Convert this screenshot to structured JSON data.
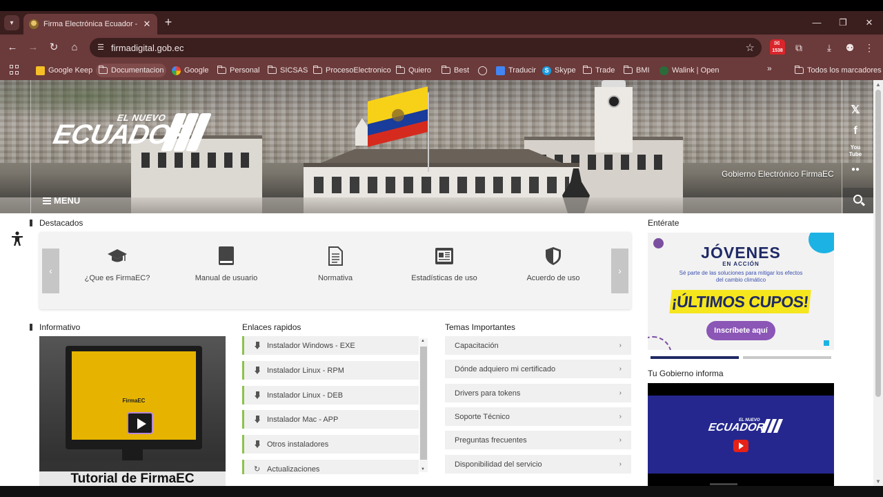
{
  "browser": {
    "tab_title": "Firma Electrónica Ecuador - Firma",
    "url": "firmadigital.gob.ec",
    "ext_badge": "1538",
    "bookmarks": [
      {
        "label": "Google Keep",
        "icon": "keep-icon"
      },
      {
        "label": "Documentacion",
        "icon": "folder-icon"
      },
      {
        "label": "Google",
        "icon": "google-icon"
      },
      {
        "label": "Personal",
        "icon": "folder-icon"
      },
      {
        "label": "SICSAS",
        "icon": "folder-icon"
      },
      {
        "label": "ProcesoElectronico",
        "icon": "folder-icon"
      },
      {
        "label": "Quiero",
        "icon": "folder-icon"
      },
      {
        "label": "Best",
        "icon": "folder-icon"
      },
      {
        "label": "",
        "icon": "globe-icon"
      },
      {
        "label": "Traducir",
        "icon": "translate-icon"
      },
      {
        "label": "Skype",
        "icon": "skype-icon"
      },
      {
        "label": "Trade",
        "icon": "folder-icon"
      },
      {
        "label": "BMI",
        "icon": "folder-icon"
      },
      {
        "label": "Walink | Open",
        "icon": "walink-icon"
      }
    ],
    "all_bookmarks": "Todos los marcadores"
  },
  "hero": {
    "logo_small": "EL NUEVO",
    "logo_big": "ECUADOR",
    "tagline": "Gobierno Electrónico FirmaEC",
    "menu_label": "MENU"
  },
  "destacados": {
    "title": "Destacados",
    "items": [
      {
        "label": "¿Que es FirmaEC?",
        "icon": "graduation-cap-icon"
      },
      {
        "label": "Manual de usuario",
        "icon": "book-icon"
      },
      {
        "label": "Normativa",
        "icon": "document-icon"
      },
      {
        "label": "Estadísticas de uso",
        "icon": "chart-icon"
      },
      {
        "label": "Acuerdo de uso",
        "icon": "shield-icon"
      }
    ]
  },
  "informativo": {
    "title": "Informativo",
    "screen_title": "FirmaEC",
    "caption": "Tutorial de FirmaEC"
  },
  "enlaces": {
    "title": "Enlaces rapidos",
    "items": [
      "Instalador Windows - EXE",
      "Instalador Linux - RPM",
      "Instalador Linux - DEB",
      "Instalador Mac - APP",
      "Otros instaladores",
      "Actualizaciones"
    ]
  },
  "temas": {
    "title": "Temas Importantes",
    "items": [
      "Capacitación",
      "Dónde adquiero mi certificado",
      "Drivers para tokens",
      "Soporte Técnico",
      "Preguntas frecuentes",
      "Disponibilidad del servicio"
    ]
  },
  "enterate": {
    "title": "Entérate",
    "banner_title": "JÓVENES",
    "banner_sub": "EN ACCIÓN",
    "banner_text": "Sé parte de las soluciones para mitigar los efectos del cambio climático",
    "banner_cupos": "¡ÚLTIMOS CUPOS!",
    "banner_button": "Inscríbete aquí",
    "active_slide": 1,
    "slide_count": 2
  },
  "gobierno": {
    "title": "Tu Gobierno informa",
    "logo_small": "EL NUEVO",
    "logo_big": "ECUADOR"
  },
  "colors": {
    "chrome_dark": "#3b1e1e",
    "chrome": "#6b3a3a",
    "link_accent": "#8bc34a",
    "banner_yellow": "#f6e61e",
    "banner_purple": "#8b56b6",
    "gov_blue": "#25278f"
  }
}
